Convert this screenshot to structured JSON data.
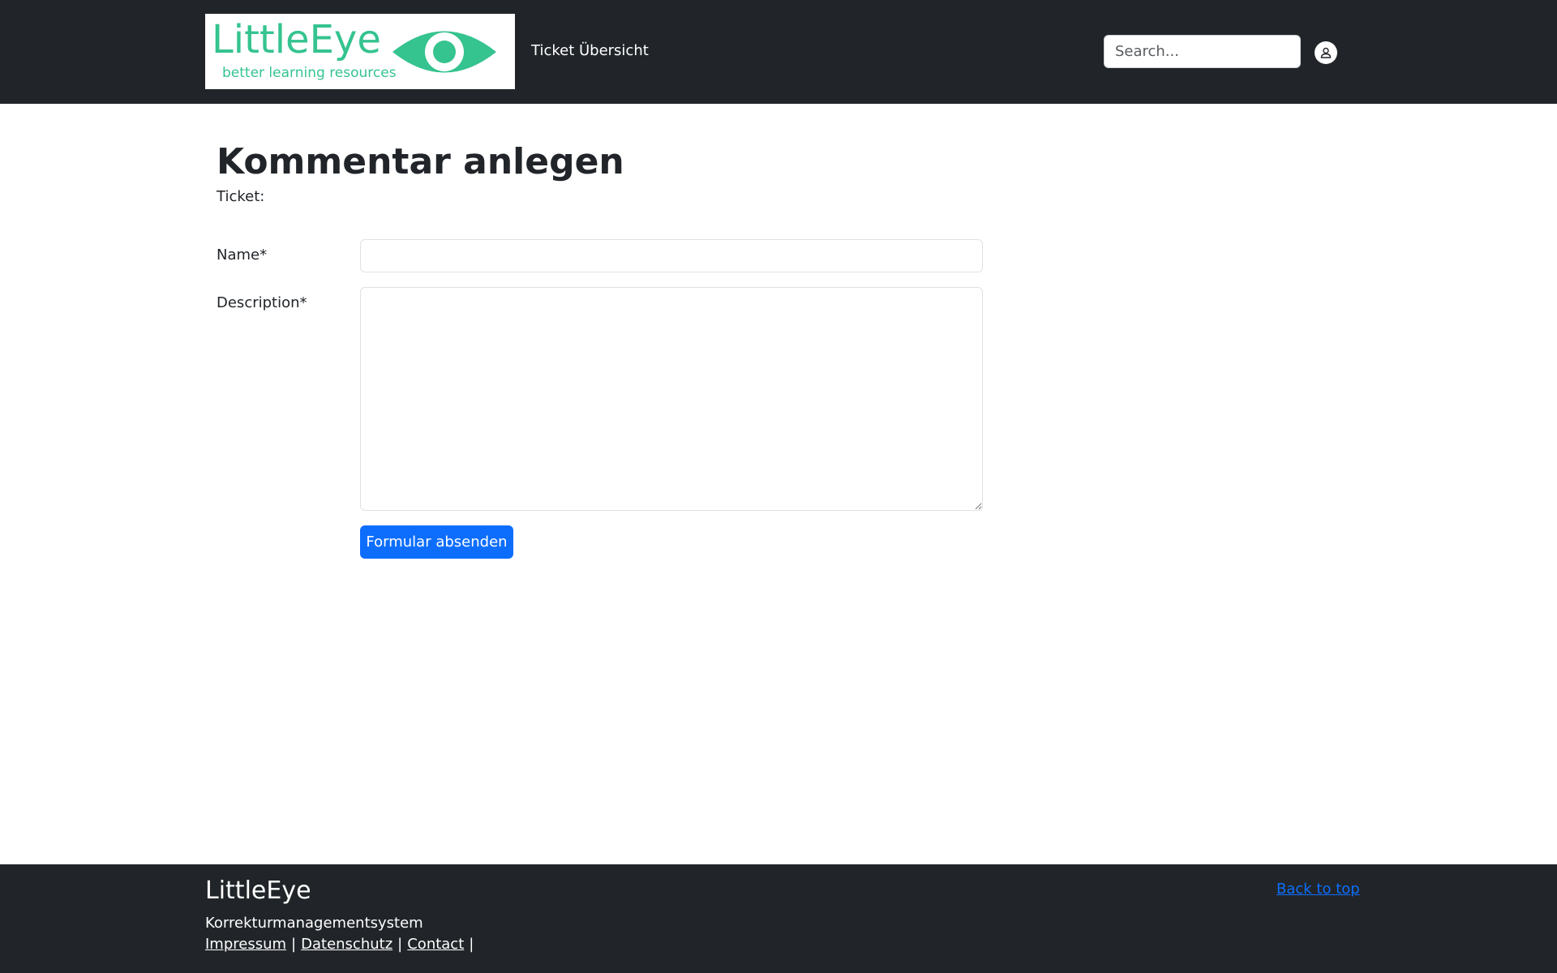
{
  "header": {
    "logo": {
      "wordmark": "LittleEye",
      "tagline": "better learning resources"
    },
    "nav_link": "Ticket Übersicht",
    "search": {
      "placeholder": "Search..."
    },
    "icons": {
      "user": "user-icon",
      "eye": "eye-logo-icon"
    }
  },
  "main": {
    "title": "Kommentar anlegen",
    "ticket_label": "Ticket:",
    "form": {
      "name_label": "Name*",
      "name_value": "",
      "description_label": "Description*",
      "description_value": "",
      "submit_label": "Formular absenden"
    }
  },
  "footer": {
    "title": "LittleEye",
    "subtitle": "Korrekturmanagementsystem",
    "links": [
      "Impressum",
      "Datenschutz",
      "Contact"
    ],
    "separator": "|",
    "back_to_top": "Back to top"
  },
  "colors": {
    "navbar_bg": "#212529",
    "brand_green": "#35c38f",
    "primary": "#0d6efd",
    "text": "#212529"
  }
}
